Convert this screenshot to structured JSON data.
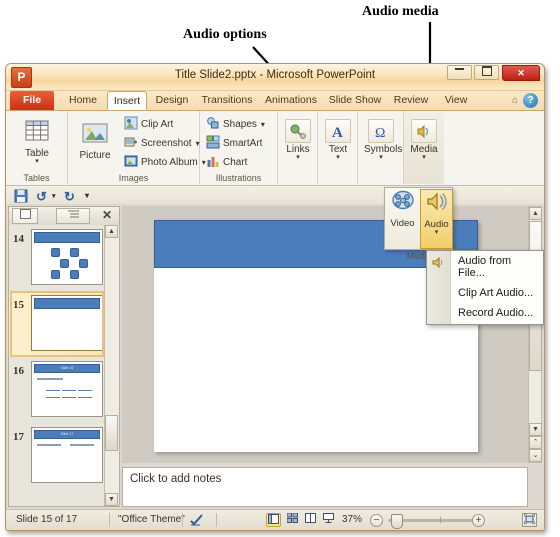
{
  "annotations": [
    {
      "id": "audio-options",
      "text": "Audio options"
    },
    {
      "id": "audio-media",
      "text": "Audio media"
    }
  ],
  "window": {
    "app_logo": "P",
    "title": "Title Slide2.pptx  -  Microsoft PowerPoint",
    "controls": {
      "minimize": "",
      "maximize": "",
      "close": "✕"
    }
  },
  "quick_access": {
    "save": "save-icon",
    "undo": "undo-icon",
    "undo_more": "▾",
    "redo": "redo-icon",
    "customize": "▾"
  },
  "ribbon": {
    "tabs": [
      {
        "label": "File",
        "selected": false
      },
      {
        "label": "Home",
        "selected": false
      },
      {
        "label": "Insert",
        "selected": true
      },
      {
        "label": "Design",
        "selected": false
      },
      {
        "label": "Transitions",
        "selected": false
      },
      {
        "label": "Animations",
        "selected": false
      },
      {
        "label": "Slide Show",
        "selected": false
      },
      {
        "label": "Review",
        "selected": false
      },
      {
        "label": "View",
        "selected": false
      }
    ],
    "collapse_icon": "⌂",
    "help_icon": "?",
    "groups": [
      {
        "name": "Tables",
        "label": "Tables",
        "buttons": [
          {
            "label": "Table",
            "caret": "▾"
          }
        ]
      },
      {
        "name": "Images",
        "label": "Images",
        "buttons": [
          {
            "label": "Picture",
            "caret": ""
          }
        ],
        "small": [
          {
            "label": "Clip Art",
            "caret": ""
          },
          {
            "label": "Screenshot",
            "caret": "▾"
          },
          {
            "label": "Photo Album",
            "caret": "▾"
          }
        ]
      },
      {
        "name": "Illustrations",
        "label": "Illustrations",
        "small": [
          {
            "label": "Shapes",
            "caret": "▾"
          },
          {
            "label": "SmartArt",
            "caret": ""
          },
          {
            "label": "Chart",
            "caret": ""
          }
        ]
      },
      {
        "name": "Links",
        "label": "",
        "buttons": [
          {
            "label": "Links",
            "caret": "▾"
          }
        ]
      },
      {
        "name": "Text",
        "label": "",
        "buttons": [
          {
            "label": "Text",
            "caret": "▾"
          }
        ]
      },
      {
        "name": "Symbols",
        "label": "",
        "buttons": [
          {
            "label": "Symbols",
            "caret": "▾"
          }
        ]
      },
      {
        "name": "Media",
        "label": "",
        "buttons": [
          {
            "label": "Media",
            "caret": "▾"
          }
        ]
      }
    ]
  },
  "media_flyout": {
    "video": {
      "label": "Video",
      "caret": "▾"
    },
    "audio": {
      "label": "Audio",
      "caret": "▾",
      "active": true
    },
    "group_label": "Media"
  },
  "audio_menu": {
    "items": [
      {
        "label": "Audio from File...",
        "accel": "f"
      },
      {
        "label": "Clip Art Audio...",
        "accel": "C"
      },
      {
        "label": "Record Audio...",
        "accel": "R"
      }
    ]
  },
  "slides_pane": {
    "tab_slides": "▤",
    "tab_outline": "▤",
    "close": "✕",
    "thumbnails": [
      {
        "number": "14",
        "type": "smartart",
        "title": ""
      },
      {
        "number": "15",
        "type": "title-only",
        "title": "",
        "selected": true
      },
      {
        "number": "16",
        "type": "table",
        "title": "Slide 16"
      },
      {
        "number": "17",
        "type": "two-content",
        "title": "Slide 17"
      }
    ],
    "scroll_up": "▲",
    "scroll_down": "▼"
  },
  "notes": {
    "placeholder": "Click to add notes"
  },
  "status_bar": {
    "slide_counter": "Slide 15 of 17",
    "theme": "\"Office Theme\"",
    "spellcheck_icon": "spellcheck-icon",
    "view_buttons": [
      {
        "name": "normal-view",
        "glyph": "▥",
        "selected": true
      },
      {
        "name": "slide-sorter-view",
        "glyph": "▦",
        "selected": false
      },
      {
        "name": "reading-view",
        "glyph": "▣",
        "selected": false
      },
      {
        "name": "slide-show-view",
        "glyph": "▽",
        "selected": false
      }
    ],
    "zoom_level": "37%",
    "zoom_out": "−",
    "zoom_in": "+",
    "fit_slide": "⛶"
  }
}
